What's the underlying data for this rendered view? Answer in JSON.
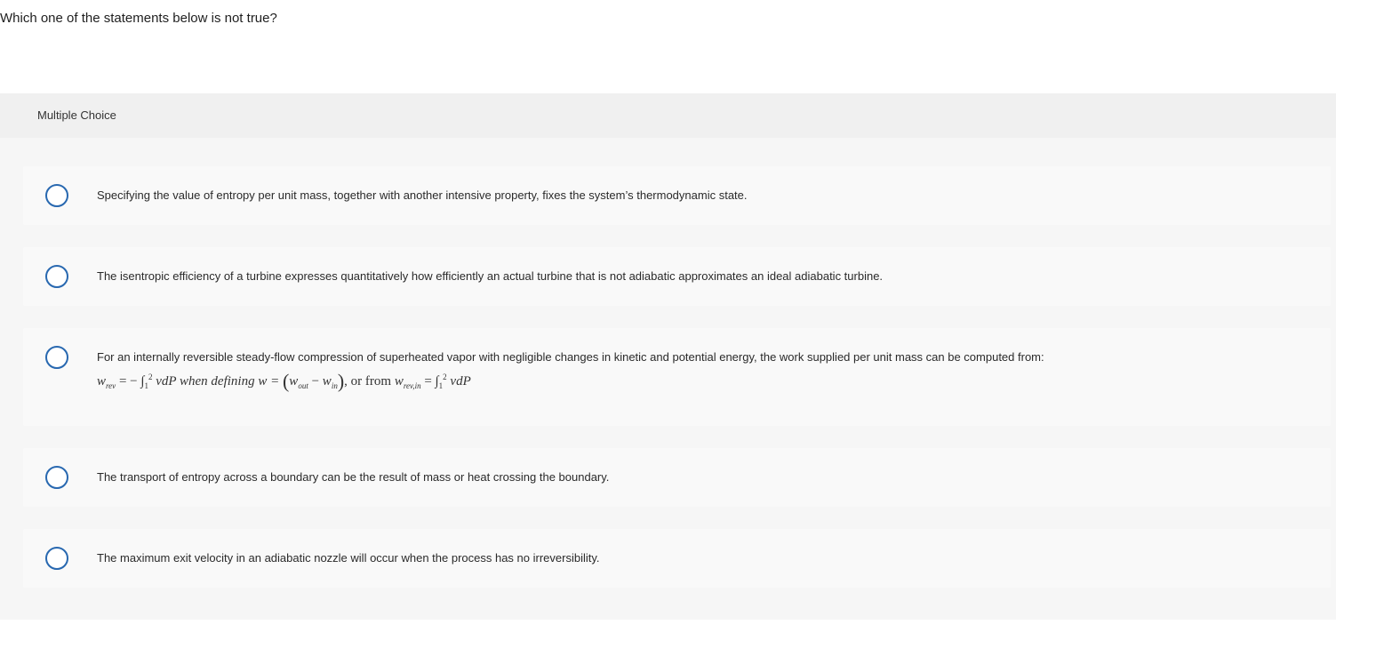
{
  "question": {
    "text": "Which one of the statements below is not true?"
  },
  "panel": {
    "header_label": "Multiple Choice"
  },
  "options": [
    {
      "text": "Specifying the value of entropy per unit mass, together with another intensive property, fixes the system’s thermodynamic state."
    },
    {
      "text": "The isentropic efficiency of a turbine expresses quantitatively how efficiently an actual turbine that is not adiabatic approximates an ideal adiabatic turbine."
    },
    {
      "text": "For an internally reversible steady-flow compression of superheated vapor with negligible changes in kinetic and potential energy, the work supplied per unit mass can be computed from:",
      "formula": {
        "w": "w",
        "rev_sub": "rev",
        "eq_neg": "= −",
        "int": "∫",
        "lower": "1",
        "upper": "2",
        "integrand": "vdP when defining w =",
        "out_sub": "out",
        "minus": "−",
        "in_sub": "in",
        "or_from": ", or from",
        "rev_in_sub": "rev,in",
        "eq": "=",
        "integrand2": "vdP"
      }
    },
    {
      "text": "The transport of entropy across a boundary can be the result of mass or heat crossing the boundary."
    },
    {
      "text": "The maximum exit velocity in an adiabatic nozzle will occur when the process has no irreversibility."
    }
  ],
  "colors": {
    "radio_border": "#2868b0",
    "panel_bg": "#f6f6f6",
    "header_bg": "#f0f0f0",
    "option_bg": "#f9f9f9"
  }
}
